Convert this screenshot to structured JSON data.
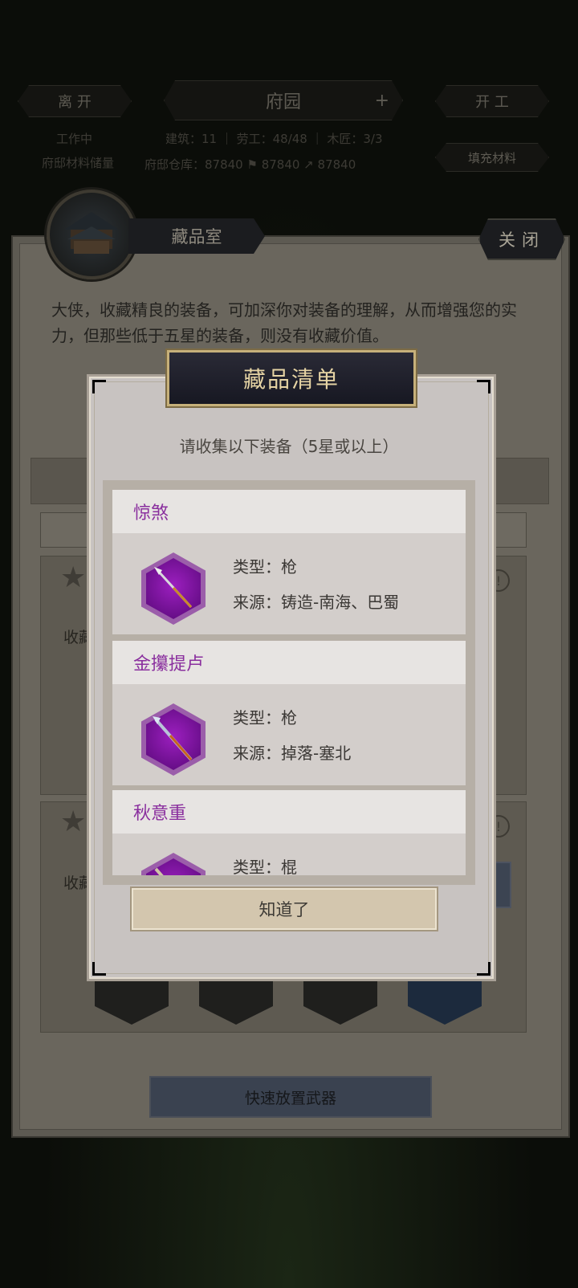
{
  "hud": {
    "leave_label": "离 开",
    "garden_title": "府园",
    "plus_symbol": "+",
    "start_label": "开 工",
    "stats_line": "建筑：11 ｜ 劳工：48/48 ｜ 木匠：3/3",
    "warehouse_line": "府邸仓库：87840 ⚑   87840 ↗   87840",
    "fill_label": "填充材料",
    "left_small_1": "工作中",
    "left_small_2": "府邸材料储量"
  },
  "panel": {
    "title": "藏品室",
    "close_label": "关闭",
    "description": "大侠，收藏精良的装备，可加深你对装备的理解，从而增强您的实力，但那些低于五星的装备，则没有收藏价值。",
    "collect_label_1": "收藏",
    "collect_label_2": "收藏",
    "alert_symbol": "!",
    "star_symbol": "★",
    "quick_place_label": "快速放置武器"
  },
  "modal": {
    "title": "藏品清单",
    "subtitle": "请收集以下装备（5星或以上）",
    "items": [
      {
        "name": "惊煞",
        "type": "类型：枪",
        "source": "来源：铸造-南海、巴蜀",
        "icon": "spear-icon"
      },
      {
        "name": "金攥提卢",
        "type": "类型：枪",
        "source": "来源：掉落-塞北",
        "icon": "spear-icon"
      },
      {
        "name": "秋意重",
        "type": "类型：棍",
        "source": "",
        "icon": "staff-icon"
      }
    ],
    "ok_label": "知道了"
  },
  "colors": {
    "item_name": "#8a2f9e",
    "rarity_hex": "#9c1fbf",
    "title_gold": "#e6d4a4"
  }
}
